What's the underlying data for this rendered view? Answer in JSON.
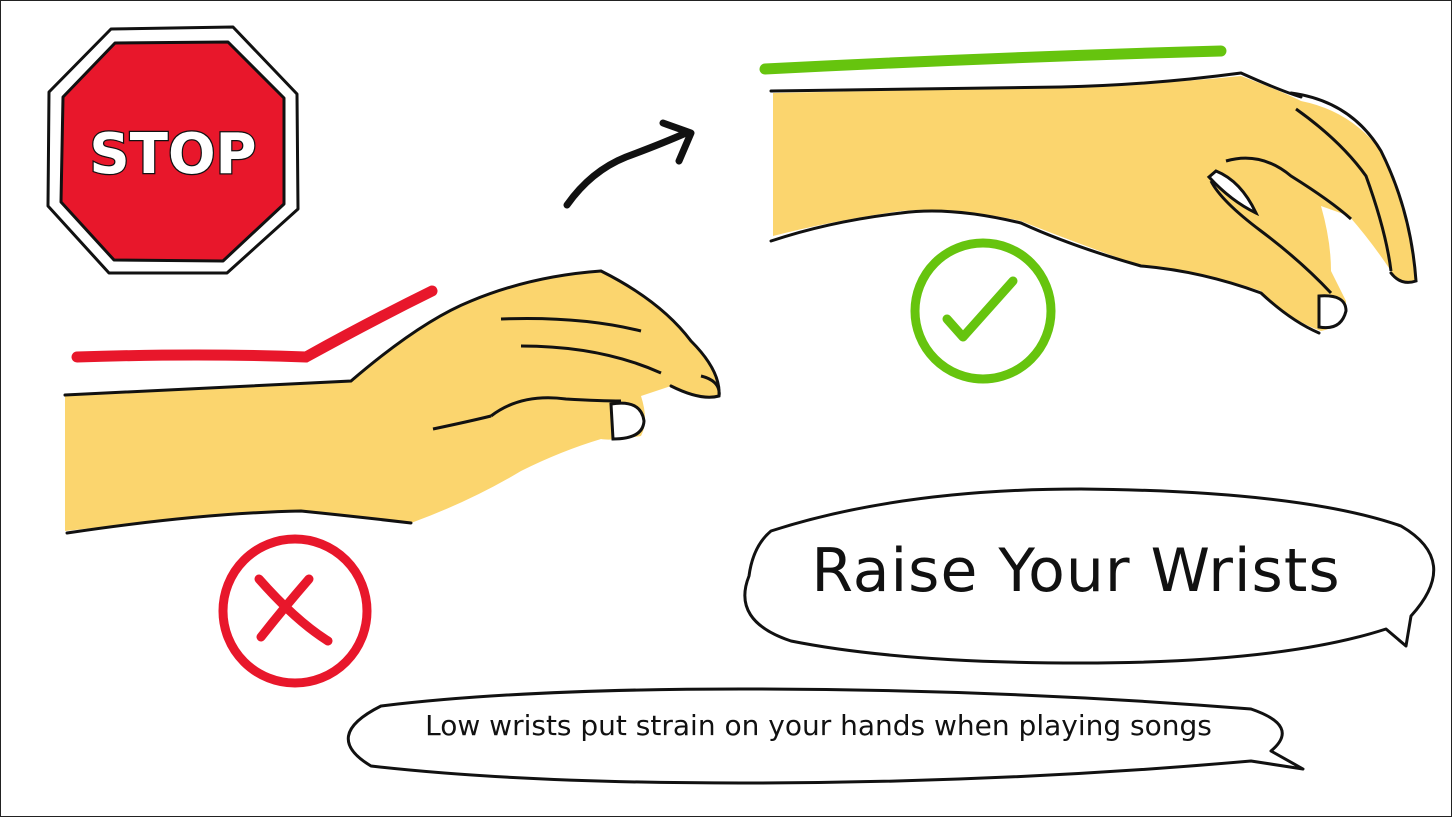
{
  "stop_sign": {
    "label": "STOP",
    "color": "#e8172b"
  },
  "bad_example": {
    "mark": "cross",
    "color": "#e8172b"
  },
  "good_example": {
    "mark": "check",
    "color": "#66c40e"
  },
  "skin_color": "#fbd56e",
  "title_bubble": {
    "text": "Raise Your Wrists"
  },
  "caption_bubble": {
    "text": "Low wrists put strain on your hands when playing songs"
  }
}
